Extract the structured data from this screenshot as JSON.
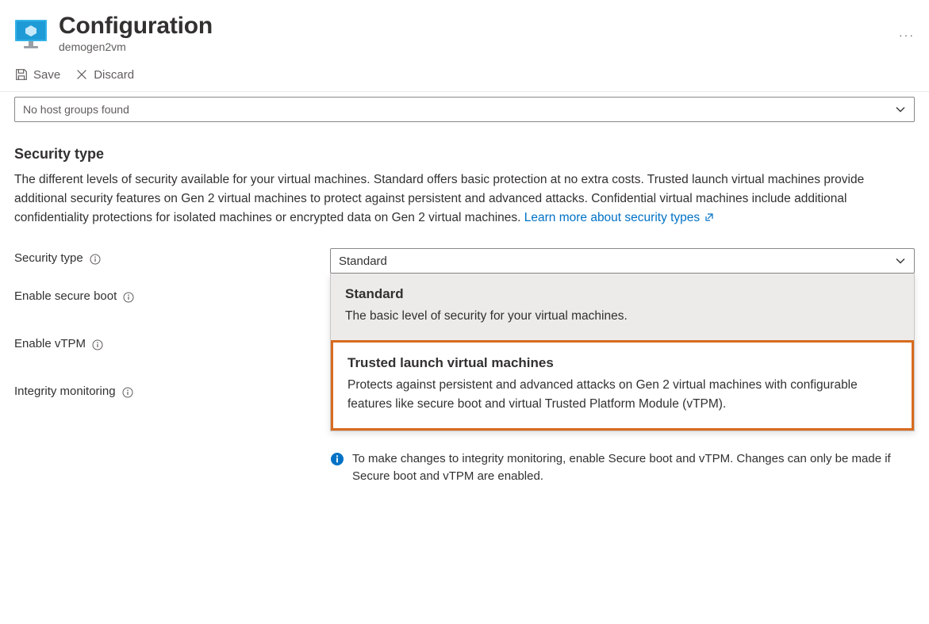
{
  "header": {
    "title": "Configuration",
    "subtitle": "demogen2vm"
  },
  "toolbar": {
    "save_label": "Save",
    "discard_label": "Discard"
  },
  "host_group_dropdown": {
    "value": "No host groups found"
  },
  "security_section": {
    "title": "Security type",
    "description": "The different levels of security available for your virtual machines. Standard offers basic protection at no extra costs. Trusted launch virtual machines provide additional security features on Gen 2 virtual machines to protect against persistent and advanced attacks. Confidential virtual machines include additional confidentiality protections for isolated machines or encrypted data on Gen 2 virtual machines.",
    "learn_more_label": "Learn more about security types"
  },
  "form": {
    "security_type_label": "Security type",
    "enable_secure_boot_label": "Enable secure boot",
    "enable_vtpm_label": "Enable vTPM",
    "integrity_monitoring_label": "Integrity monitoring",
    "security_type_selected": "Standard",
    "dropdown_options": {
      "standard": {
        "title": "Standard",
        "desc": "The basic level of security for your virtual machines."
      },
      "trusted": {
        "title": "Trusted launch virtual machines",
        "desc": "Protects against persistent and advanced attacks on Gen 2 virtual machines with configurable features like secure boot and virtual Trusted Platform Module (vTPM)."
      }
    }
  },
  "info_message": "To make changes to integrity monitoring, enable Secure boot and vTPM. Changes can only be made if Secure boot and vTPM are enabled."
}
